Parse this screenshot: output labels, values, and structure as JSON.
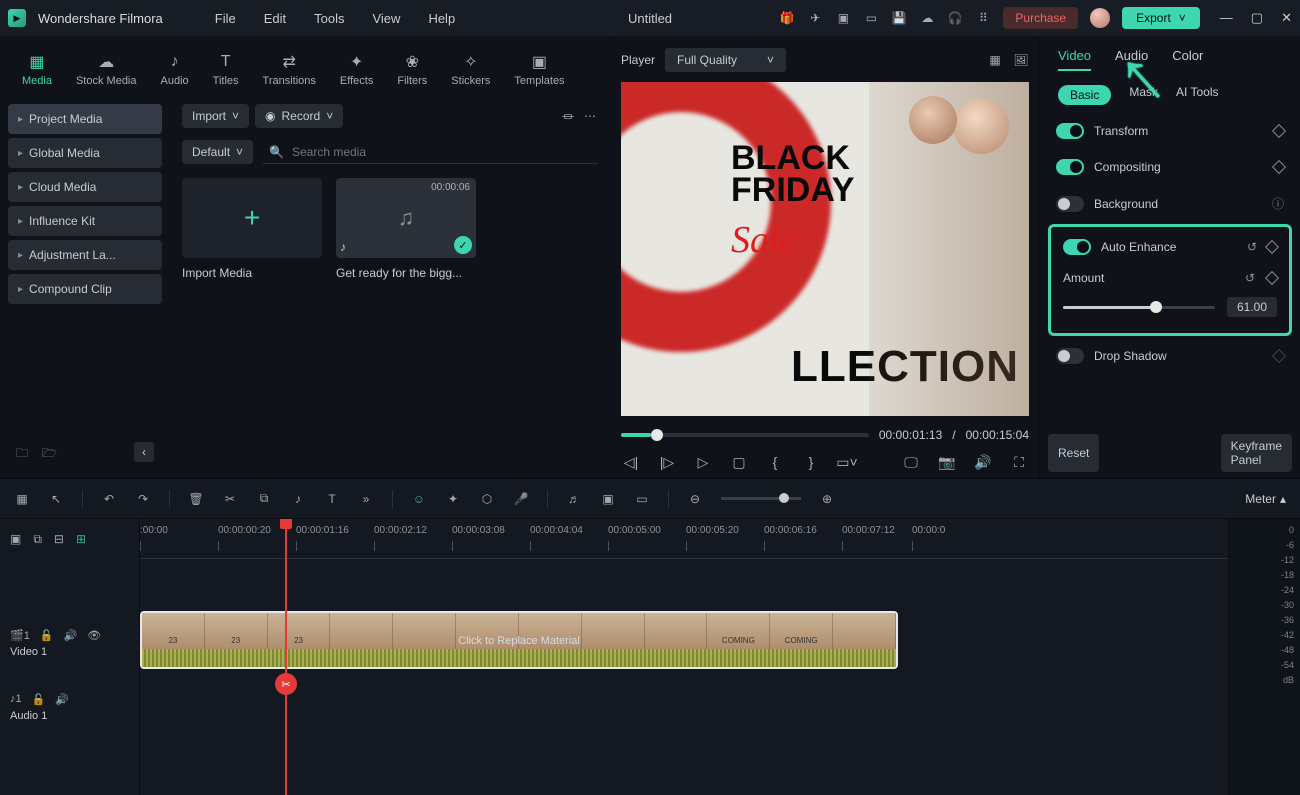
{
  "app_name": "Wondershare Filmora",
  "doc_title": "Untitled",
  "menus": [
    "File",
    "Edit",
    "Tools",
    "View",
    "Help"
  ],
  "purchase": "Purchase",
  "export": "Export",
  "asset_tabs": [
    {
      "icon": "▦",
      "label": "Media"
    },
    {
      "icon": "☁",
      "label": "Stock Media"
    },
    {
      "icon": "♪",
      "label": "Audio"
    },
    {
      "icon": "T",
      "label": "Titles"
    },
    {
      "icon": "⇄",
      "label": "Transitions"
    },
    {
      "icon": "✦",
      "label": "Effects"
    },
    {
      "icon": "❀",
      "label": "Filters"
    },
    {
      "icon": "✧",
      "label": "Stickers"
    },
    {
      "icon": "▣",
      "label": "Templates"
    }
  ],
  "sidebar": {
    "items": [
      "Project Media",
      "Global Media",
      "Cloud Media",
      "Influence Kit",
      "Adjustment La...",
      "Compound Clip"
    ]
  },
  "media_panel": {
    "import": "Import",
    "record": "Record",
    "sort": "Default",
    "search_placeholder": "Search media",
    "import_card": "Import Media",
    "clip": {
      "duration": "00:00:06",
      "name": "Get ready for the bigg..."
    }
  },
  "preview": {
    "player": "Player",
    "quality": "Full Quality",
    "text1": "BLACK",
    "text2": "FRIDAY",
    "sale": "Sale",
    "collection": "LLECTION",
    "current": "00:00:01:13",
    "total": "00:00:15:04"
  },
  "inspector": {
    "tabs": [
      "Video",
      "Audio",
      "Color"
    ],
    "subtabs": [
      "Basic",
      "Mask",
      "AI Tools"
    ],
    "transform": "Transform",
    "compositing": "Compositing",
    "background": "Background",
    "auto_enhance": "Auto Enhance",
    "amount": "Amount",
    "amount_value": "61.00",
    "drop_shadow": "Drop Shadow",
    "reset": "Reset",
    "keyframe": "Keyframe Panel"
  },
  "timeline": {
    "meter": "Meter",
    "ruler": [
      ":00:00",
      "00:00:00:20",
      "00:00:01:16",
      "00:00:02:12",
      "00:00:03:08",
      "00:00:04:04",
      "00:00:05:00",
      "00:00:05:20",
      "00:00:06:16",
      "00:00:07:12",
      "00:00:0"
    ],
    "video_track": "Video 1",
    "audio_track": "Audio 1",
    "clip_label": "Click to Replace Material",
    "meter_scale": [
      "0",
      "-6",
      "-12",
      "-18",
      "-24",
      "-30",
      "-36",
      "-42",
      "-48",
      "-54",
      "dB"
    ]
  }
}
